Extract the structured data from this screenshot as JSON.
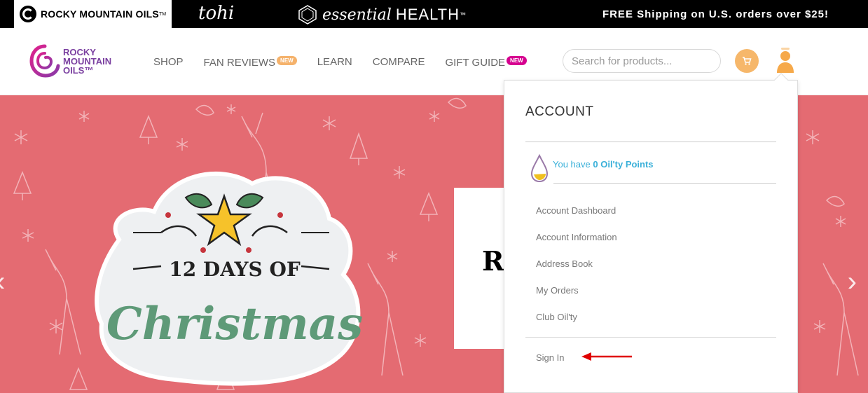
{
  "topbar": {
    "brand_rmo": "ROCKY MOUNTAIN OILS",
    "brand_rmo_tm": "TM",
    "brand_tohi": "tohi",
    "brand_eh_essential": "essential",
    "brand_eh_health": "HEALTH",
    "brand_eh_tm": "™",
    "shipping": "FREE Shipping on U.S. orders over $25!"
  },
  "header": {
    "logo_line1": "ROCKY",
    "logo_line2": "MOUNTAIN",
    "logo_line3": "OILS™",
    "nav": [
      {
        "label": "SHOP"
      },
      {
        "label": "FAN REVIEWS",
        "badge": "NEW"
      },
      {
        "label": "LEARN"
      },
      {
        "label": "COMPARE"
      },
      {
        "label": "GIFT GUIDE",
        "badge": "NEW"
      }
    ],
    "search_placeholder": "Search for products..."
  },
  "hero": {
    "sticker_line1": "12 DAYS OF",
    "sticker_line2": "Christmas",
    "card_text": "Ro",
    "background_color": "#e46b72"
  },
  "account": {
    "title": "ACCOUNT",
    "points_prefix": "You have",
    "points_value": "0 Oil'ty Points",
    "links": [
      {
        "label": "Account Dashboard"
      },
      {
        "label": "Account Information"
      },
      {
        "label": "Address Book"
      },
      {
        "label": "My Orders"
      },
      {
        "label": "Club Oil'ty"
      }
    ],
    "sign_in": "Sign In"
  },
  "colors": {
    "brand_purple": "#7a3fa0",
    "brand_pink": "#d6008f",
    "accent_orange": "#f6b76a",
    "points_blue": "#3ab0d9",
    "annotation_red": "#e00000"
  },
  "icons": [
    "cart-icon",
    "user-icon",
    "oil-drop-icon",
    "hexagon-icon",
    "chevron-left-icon",
    "chevron-right-icon"
  ]
}
